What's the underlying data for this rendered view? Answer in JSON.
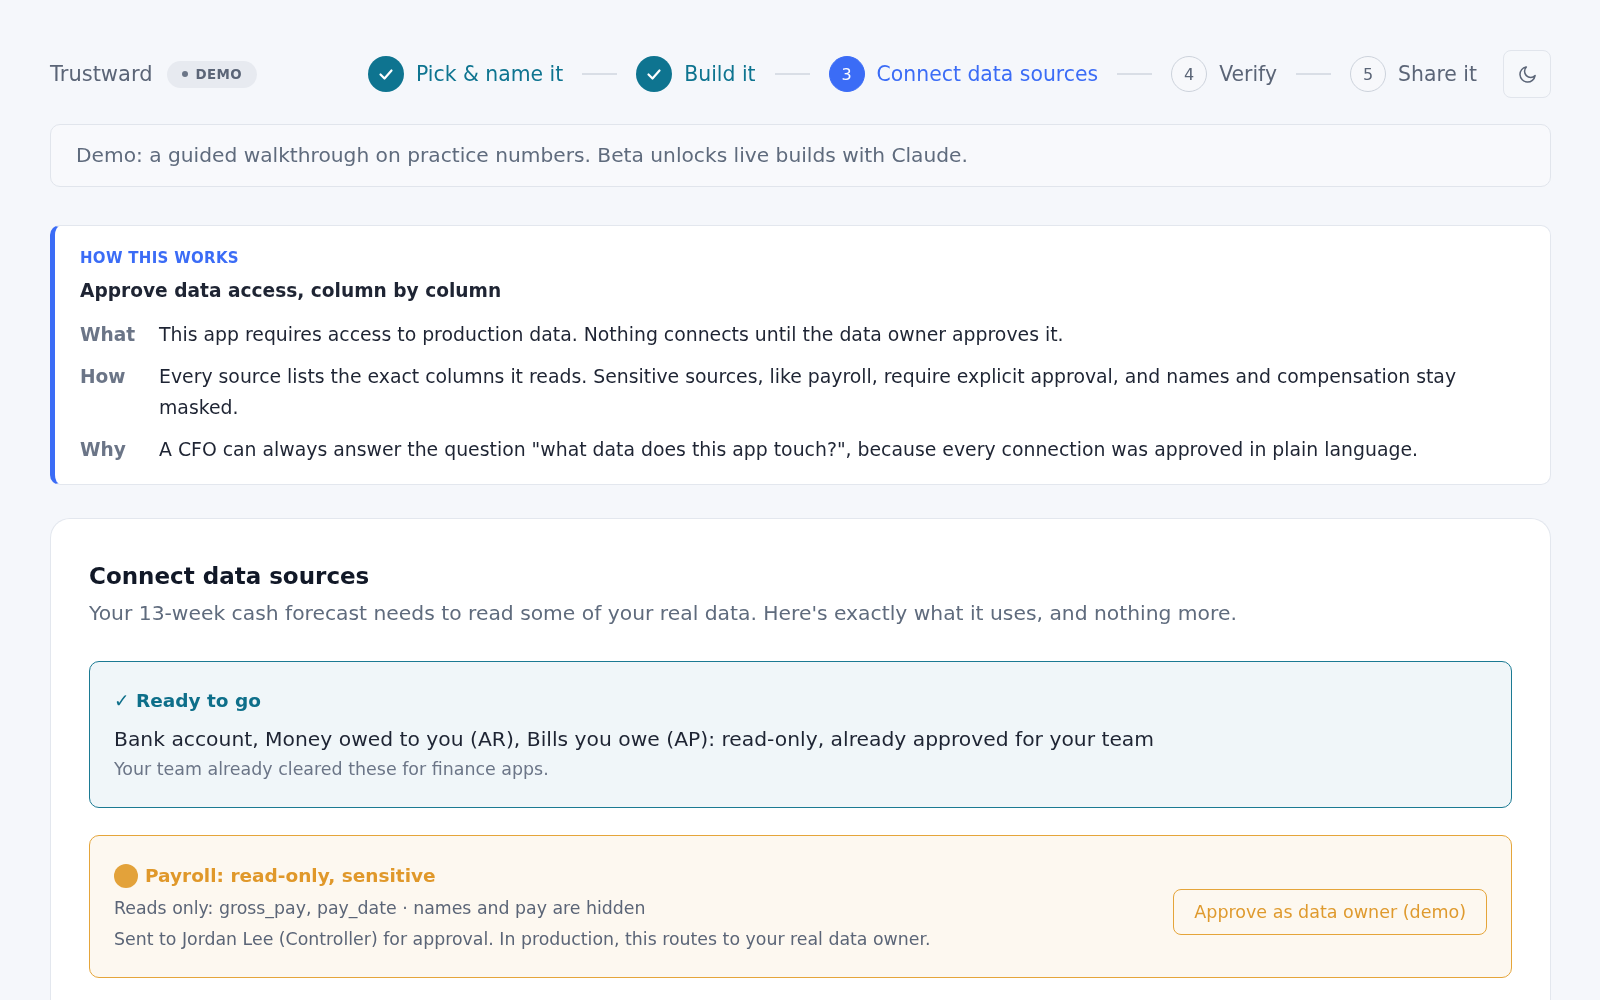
{
  "header": {
    "brand": "Trustward",
    "badge": "DEMO"
  },
  "steps": [
    {
      "label": "Pick & name it",
      "completed": true,
      "selected": false
    },
    {
      "label": "Build it",
      "completed": true,
      "selected": false
    },
    {
      "label": "Connect data sources",
      "number": "3",
      "completed": false,
      "selected": true
    },
    {
      "label": "Verify",
      "number": "4",
      "completed": false,
      "selected": false
    },
    {
      "label": "Share it",
      "number": "5",
      "completed": false,
      "selected": false
    }
  ],
  "notice": "Demo: a guided walkthrough on practice numbers. Beta unlocks live builds with Claude.",
  "how_it_works": {
    "eyebrow": "HOW THIS WORKS",
    "title": "Approve data access, column by column",
    "rows": [
      {
        "label": "What",
        "text": "This app requires access to production data. Nothing connects until the data owner approves it."
      },
      {
        "label": "How",
        "text": "Every source lists the exact columns it reads. Sensitive sources, like payroll, require explicit approval, and names and compensation stay masked."
      },
      {
        "label": "Why",
        "text": "A CFO can always answer the question \"what data does this app touch?\", because every connection was approved in plain language."
      }
    ]
  },
  "main": {
    "title": "Connect data sources",
    "subtitle": "Your 13-week cash forecast needs to read some of your real data. Here's exactly what it uses, and nothing more.",
    "sources": [
      {
        "kind": "approved",
        "title": "✓ Ready to go",
        "summary": "Bank account, Money owed to you (AR), Bills you owe (AP): read-only, already approved for your team",
        "note": "Your team already cleared these for finance apps."
      },
      {
        "kind": "pending",
        "title": "Payroll: read-only, sensitive",
        "lines": [
          "Reads only: gross_pay, pay_date · names and pay are hidden",
          "Sent to Jordan Lee (Controller) for approval. In production, this routes to your real data owner."
        ],
        "button": "Approve as data owner (demo)"
      }
    ]
  }
}
